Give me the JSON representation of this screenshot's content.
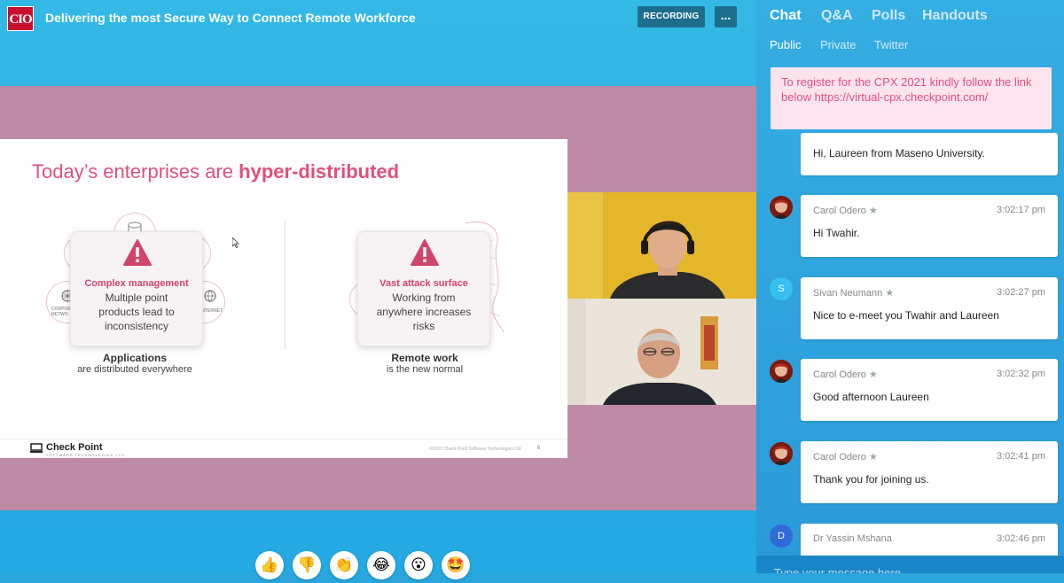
{
  "header": {
    "logo_text": "CIO",
    "event_title": "Delivering the most Secure Way to Connect Remote Workforce",
    "recording_label": "RECORDING",
    "more_label": "..."
  },
  "slide": {
    "title_normal": "Today’s enterprises are ",
    "title_bold": "hyper-distributed",
    "card_left": {
      "heading": "Complex management",
      "body_1": "Multiple point",
      "body_2": "products lead to",
      "body_3": "inconsistency"
    },
    "card_right": {
      "heading": "Vast attack surface",
      "body_1": "Working from",
      "body_2": "anywhere increases",
      "body_3": "risks"
    },
    "caption_left_bold": "Applications",
    "caption_left": "are distributed everywhere",
    "caption_right_bold": "Remote work",
    "caption_right": "is the new normal",
    "ghost_corporate": "CORPORATE NETWO",
    "ghost_internet": "INTERNET",
    "logo_text": "Check Point",
    "logo_sub": "SOFTWARE TECHNOLOGIES LTD",
    "copyright": "©2021 Check Point Software Technologies Ltd.",
    "page_number": "6"
  },
  "reactions": [
    "👍",
    "👎",
    "👏",
    "😂",
    "😮",
    "🤩"
  ],
  "panel": {
    "tabs": [
      "Chat",
      "Q&A",
      "Polls",
      "Handouts"
    ],
    "subtabs": [
      "Public",
      "Private",
      "Twitter"
    ],
    "notice": "To register for the CPX 2021 kindly follow the link below https://virtual-cpx.checkpoint.com/",
    "messages": [
      {
        "name": "",
        "time": "",
        "text": "Hi, Laureen from Maseno University."
      },
      {
        "name": "Carol Odero",
        "time": "3:02:17 pm",
        "text": "Hi Twahir."
      },
      {
        "name": "Sivan Neumann",
        "time": "3:02:27 pm",
        "text": "Nice to e-meet you Twahir and Laureen",
        "initial": "S"
      },
      {
        "name": "Carol Odero",
        "time": "3:02:32 pm",
        "text": "Good afternoon Laureen"
      },
      {
        "name": "Carol Odero",
        "time": "3:02:41 pm",
        "text": "Thank you for joining us."
      },
      {
        "name": "Dr Yassin Mshana",
        "time": "3:02:46 pm",
        "text": "",
        "initial": "D"
      }
    ],
    "compose_placeholder": "Type your message here"
  },
  "colors": {
    "brand_red": "#c8102e",
    "accent_pink": "#e0507a",
    "panel_blue": "#2a9ad8",
    "media_band": "#bd8ba5",
    "recording_btn": "#1d6e8c"
  },
  "icons": {
    "warning": "warning-triangle-icon",
    "star": "star-icon",
    "more": "ellipsis-icon"
  }
}
